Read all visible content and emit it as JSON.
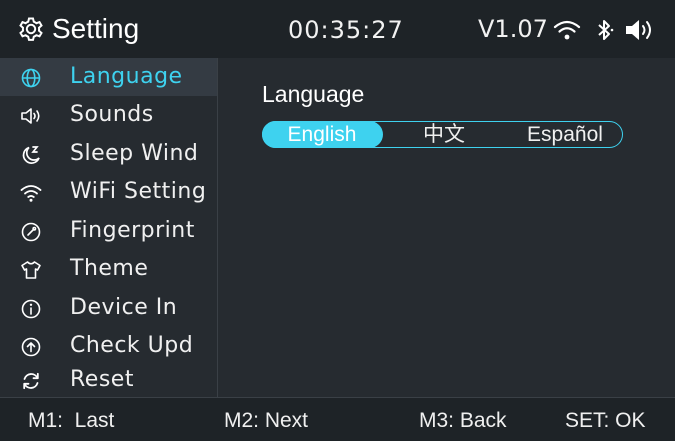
{
  "header": {
    "title": "Setting",
    "time": "00:35:27",
    "version": "V1.07",
    "icons": [
      "gear-icon",
      "wifi-icon",
      "bluetooth-icon",
      "volume-icon"
    ]
  },
  "sidebar": {
    "items": [
      {
        "label": "Language",
        "icon": "globe-icon",
        "active": true
      },
      {
        "label": "Sounds",
        "icon": "speaker-icon",
        "active": false
      },
      {
        "label": "Sleep Wind",
        "icon": "moon-sleep-icon",
        "active": false
      },
      {
        "label": "WiFi Setting",
        "icon": "wifi-icon",
        "active": false
      },
      {
        "label": "Fingerprint",
        "icon": "fingerprint-icon",
        "active": false
      },
      {
        "label": "Theme",
        "icon": "shirt-icon",
        "active": false
      },
      {
        "label": "Device In",
        "icon": "info-icon",
        "active": false
      },
      {
        "label": "Check Upd",
        "icon": "upload-icon",
        "active": false
      },
      {
        "label": "Reset",
        "icon": "reset-icon",
        "active": false
      }
    ]
  },
  "main": {
    "section_title": "Language",
    "options": [
      "English",
      "中文",
      "Español"
    ],
    "selected": "English"
  },
  "footer": {
    "m1": "M1:  Last",
    "m2": "M2: Next",
    "m3": "M3: Back",
    "set": "SET: OK"
  },
  "colors": {
    "accent": "#3ed2ef",
    "background": "#262b30",
    "header_bg": "#1e2327",
    "active_row": "#343b43"
  }
}
